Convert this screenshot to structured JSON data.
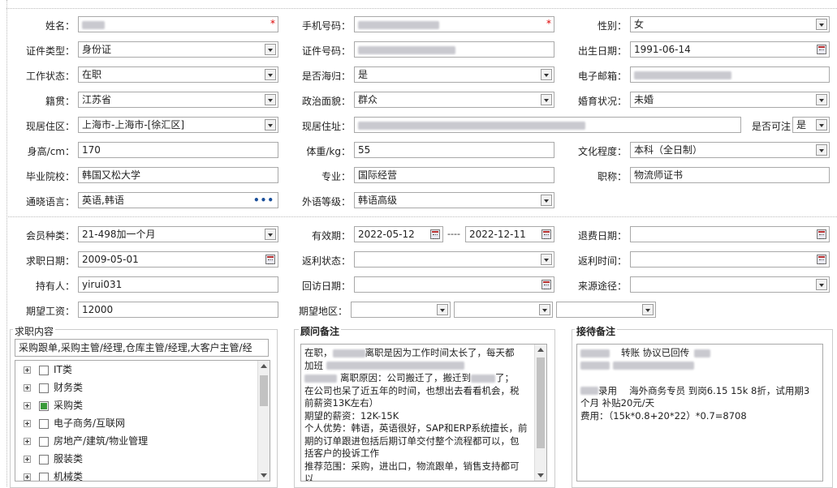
{
  "labels": {
    "name": "姓名：",
    "phone": "手机号码：",
    "gender": "性别：",
    "id_type": "证件类型：",
    "id_no": "证件号码：",
    "birth": "出生日期：",
    "work_status": "工作状态：",
    "returnee": "是否海归：",
    "email": "电子邮箱：",
    "native": "籍贯：",
    "political": "政治面貌：",
    "marital": "婚育状况：",
    "region": "现居住区：",
    "address": "现居住址：",
    "visitable": "是否可注",
    "height": "身高/cm：",
    "weight": "体重/kg：",
    "education": "文化程度：",
    "school": "毕业院校：",
    "major": "专业：",
    "title": "职称：",
    "languages": "通晓语言：",
    "lang_level": "外语等级：",
    "member_type": "会员种类：",
    "valid": "有效期：",
    "refund_date": "退费日期：",
    "apply_date": "求职日期：",
    "rebate_status": "返利状态：",
    "rebate_time": "返利时间：",
    "holder": "持有人：",
    "revisit_date": "回访日期：",
    "source": "来源途径：",
    "expected_salary": "期望工资：",
    "expected_area": "期望地区："
  },
  "values": {
    "gender": "女",
    "id_type": "身份证",
    "birth": "1991-06-14",
    "work_status": "在职",
    "returnee": "是",
    "native": "江苏省",
    "political": "群众",
    "marital": "未婚",
    "region": "上海市-上海市-[徐汇区]",
    "visitable": "是",
    "height": "170",
    "weight": "55",
    "education": "本科（全日制）",
    "school": "韩国又松大学",
    "major": "国际经营",
    "title": "物流师证书",
    "languages": "英语,韩语",
    "lang_level": "韩语高级",
    "member_type": "21-498加一个月",
    "valid_from": "2022-05-12",
    "valid_sep": "----",
    "valid_to": "2022-12-11",
    "apply_date": "2009-05-01",
    "holder": "yirui031",
    "expected_salary": "12000"
  },
  "job_panel": {
    "title": "求职内容",
    "selected_text": "采购跟单,采购主管/经理,仓库主管/经理,大客户主管/经",
    "categories": [
      {
        "label": "IT类",
        "checked": false
      },
      {
        "label": "财务类",
        "checked": false
      },
      {
        "label": "采购类",
        "checked": true
      },
      {
        "label": "电子商务/互联网",
        "checked": false
      },
      {
        "label": "房地产/建筑/物业管理",
        "checked": false
      },
      {
        "label": "服装类",
        "checked": false
      },
      {
        "label": "机械类",
        "checked": false
      }
    ]
  },
  "consultant_panel": {
    "title": "顾问备注",
    "l1": "在职，",
    "l1b": "离职是因为工作时间太长了，每天都",
    "l2": "加班",
    "l3": "离职原因：公司搬迁了，搬迁到",
    "l3b": "了；",
    "l4": "在公司也呆了近五年的时间，也想出去看看机会，税",
    "l5": "前薪资13K左右）",
    "l6": "期望的薪资：12K-15K",
    "l7": "个人优势：韩语，英语很好，SAP和ERP系统擅长，前",
    "l8": "期的订单跟进包括后期订单交付整个流程都可以，包",
    "l9": "括客户的投诉工作",
    "l10": "推荐范围：采购，进出口，物流跟单，销售支持都可",
    "l11": "以"
  },
  "reception_panel": {
    "title": "接待备注",
    "l1": "转账 协议已回传",
    "l2": "录用　 海外商务专员 到岗6.15 15k 8折，试用期3",
    "l3": "个月 补贴20元/天",
    "l4": "费用：（15k*0.8+20*22）*0.7=8708"
  }
}
